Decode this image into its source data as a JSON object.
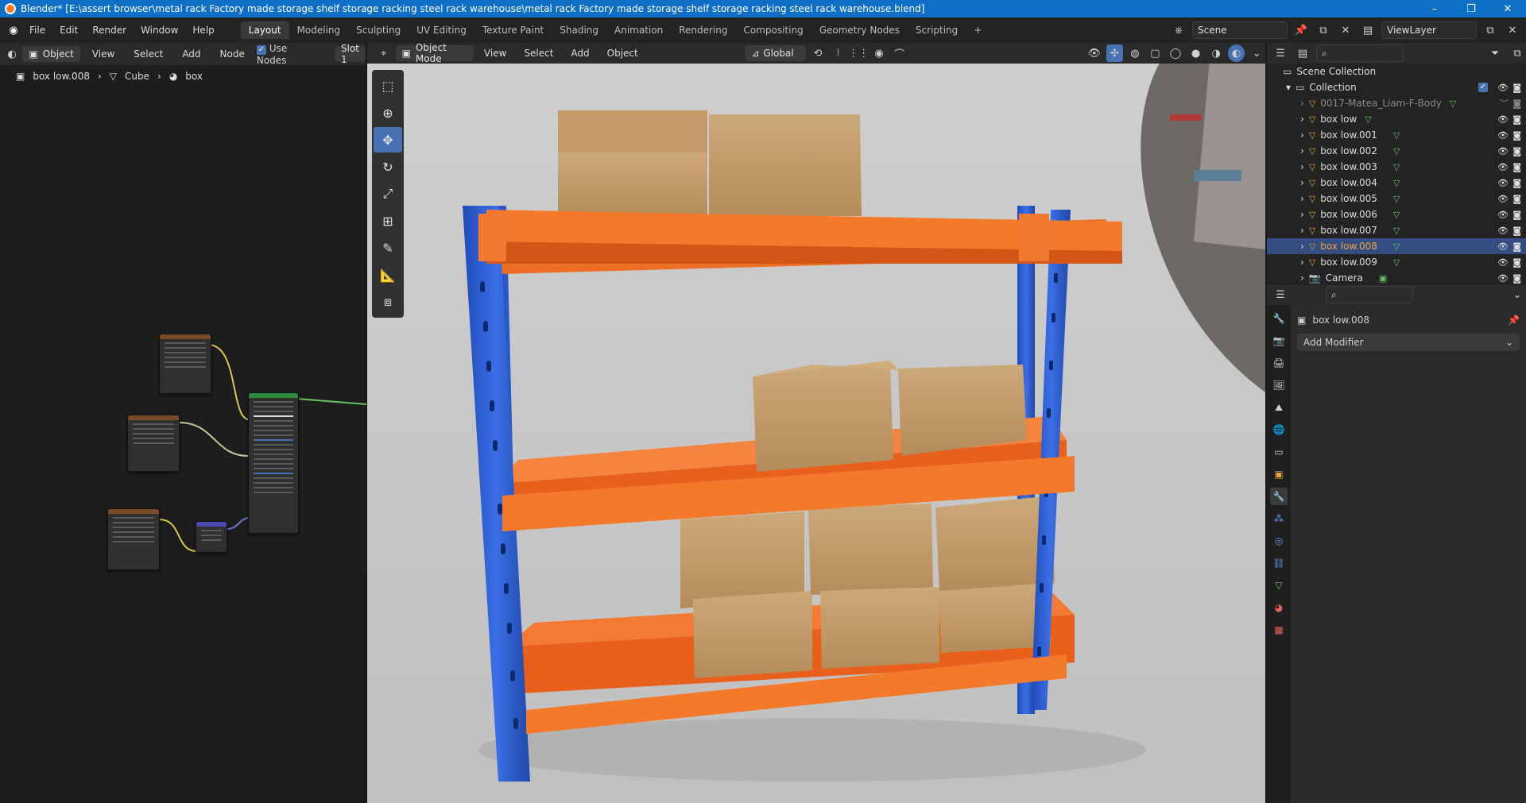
{
  "window": {
    "title": "Blender* [E:\\assert browser\\metal rack Factory made storage shelf storage racking steel rack warehouse\\metal rack Factory made storage shelf storage racking steel rack warehouse.blend]",
    "min": "–",
    "max": "❐",
    "close": "✕"
  },
  "menu": [
    "File",
    "Edit",
    "Render",
    "Window",
    "Help"
  ],
  "workspaces": [
    "Layout",
    "Modeling",
    "Sculpting",
    "UV Editing",
    "Texture Paint",
    "Shading",
    "Animation",
    "Rendering",
    "Compositing",
    "Geometry Nodes",
    "Scripting"
  ],
  "workspace_add": "+",
  "scene": "Scene",
  "view_layer": "ViewLayer",
  "node_editor": {
    "object_dropdown": "Object",
    "menus": [
      "View",
      "Select",
      "Add",
      "Node"
    ],
    "use_nodes_label": "Use Nodes",
    "slot": "Slot 1",
    "breadcrumb": [
      "box low.008",
      "Cube",
      "box"
    ]
  },
  "viewport": {
    "mode": "Object Mode",
    "menus": [
      "View",
      "Select",
      "Add",
      "Object"
    ],
    "transform": "Global"
  },
  "outliner": {
    "scene_collection": "Scene Collection",
    "collection": "Collection",
    "items": [
      {
        "name": "0017-Matea_Liam-F-Body",
        "dim": true
      },
      {
        "name": "box low"
      },
      {
        "name": "box low.001"
      },
      {
        "name": "box low.002"
      },
      {
        "name": "box low.003"
      },
      {
        "name": "box low.004"
      },
      {
        "name": "box low.005"
      },
      {
        "name": "box low.006"
      },
      {
        "name": "box low.007"
      },
      {
        "name": "box low.008",
        "selected": true
      },
      {
        "name": "box low.009"
      },
      {
        "name": "Camera",
        "camera": true
      }
    ]
  },
  "properties": {
    "object_name": "box low.008",
    "add_modifier": "Add Modifier"
  },
  "colors": {
    "accent": "#4772b3",
    "title_bar": "#0f6fc6",
    "rack_blue": "#2f5fd4",
    "rack_orange": "#f26a1f",
    "box": "#c49a66"
  }
}
